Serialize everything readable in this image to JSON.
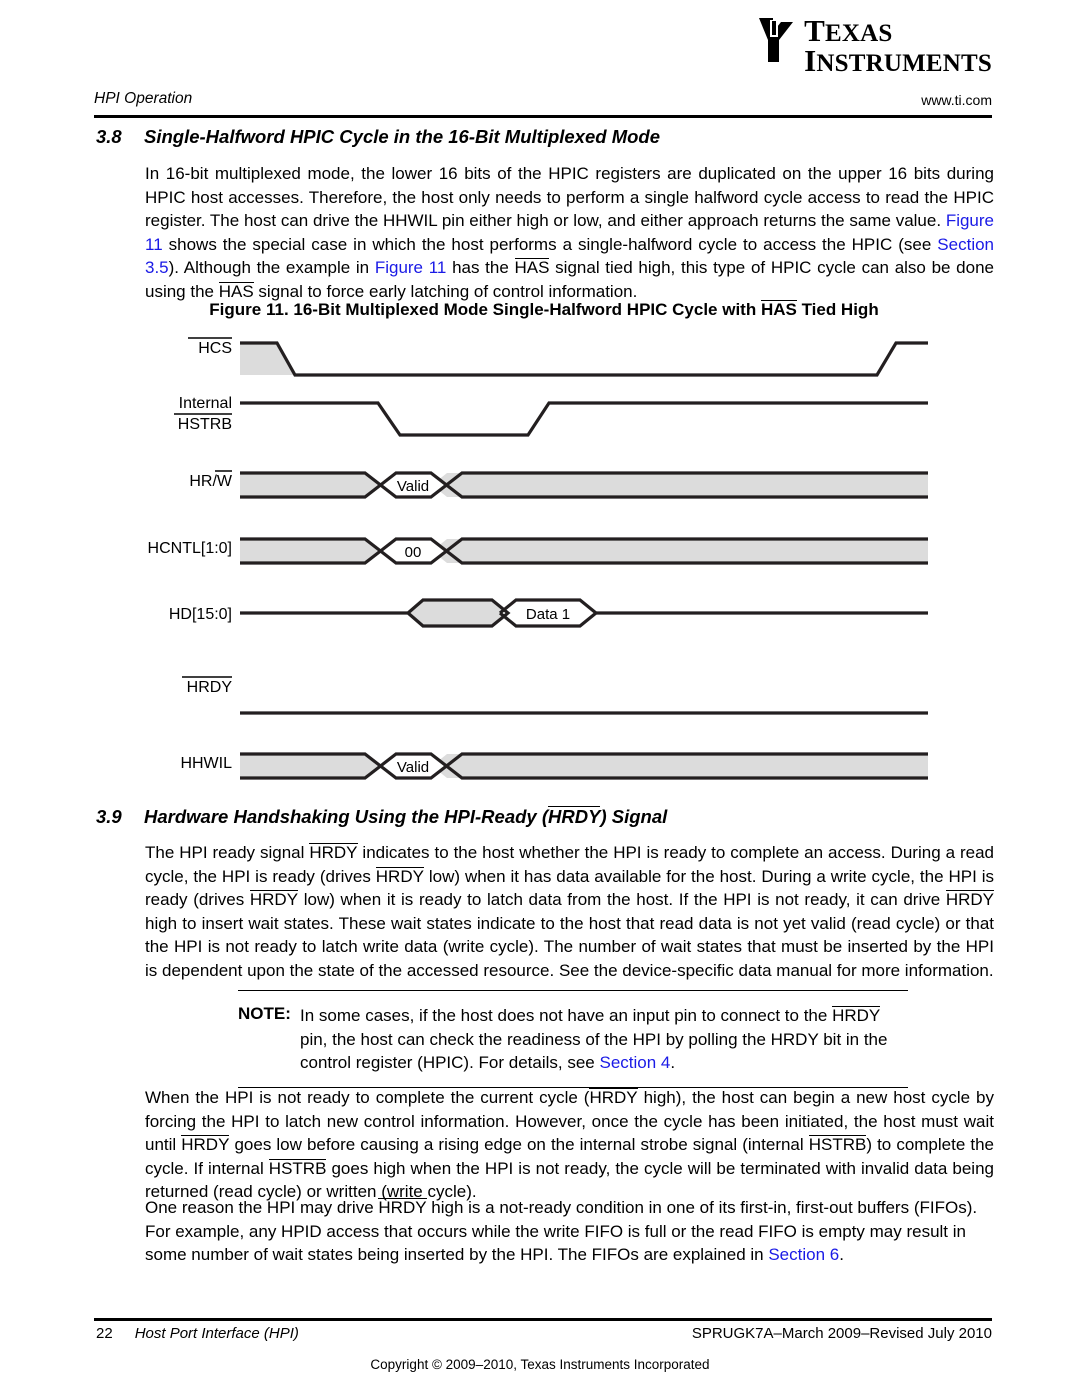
{
  "logo": {
    "line1": "TEXAS",
    "line2": "INSTRUMENTS",
    "mark_name": "ti-flame-mark"
  },
  "header": {
    "left": "HPI Operation",
    "right": "www.ti.com"
  },
  "sections": [
    {
      "number": "3.8",
      "title": "Single-Halfword HPIC Cycle in the 16-Bit Multiplexed Mode"
    },
    {
      "number": "3.9",
      "title_pre": "Hardware Handshaking Using the HPI-Ready (",
      "title_ovl": "HRDY",
      "title_post": ") Signal"
    }
  ],
  "paragraph_38": {
    "t1": "In 16-bit multiplexed mode, the lower 16 bits of the HPIC registers are duplicated on the upper 16 bits during HPIC host accesses. Therefore, the host only needs to perform a single halfword cycle access to read the HPIC register. The host can drive the HHWIL pin either high or low, and either approach returns the same value. ",
    "link1": "Figure 11",
    "t2": " shows the special case in which the host performs a single-halfword cycle to access the HPIC (see ",
    "link2": "Section 3.5",
    "t3": "). Although the example in ",
    "link3": "Figure 11",
    "t4": " has the ",
    "ovl1": "HAS",
    "t5": " signal tied high, this type of HPIC cycle can also be done using the ",
    "ovl2": "HAS",
    "t6": " signal to force early latching of control information."
  },
  "figure": {
    "caption_pre": "Figure 11. 16-Bit Multiplexed Mode Single-Halfword HPIC Cycle with ",
    "caption_ovl": "HAS",
    "caption_post": " Tied High",
    "signals": [
      {
        "name": "HCS",
        "overline": true,
        "type": "strobe"
      },
      {
        "name_line1": "Internal",
        "name": "HSTRB",
        "overline": true,
        "type": "strobe"
      },
      {
        "name": "HR/W",
        "overline_part": "W",
        "type": "bus",
        "value": "Valid"
      },
      {
        "name": "HCNTL[1:0]",
        "type": "bus",
        "value": "00"
      },
      {
        "name": "HD[15:0]",
        "type": "data",
        "value": "Data 1"
      },
      {
        "name": "HRDY",
        "overline": true,
        "type": "low"
      },
      {
        "name": "HHWIL",
        "type": "bus",
        "value": "Valid"
      }
    ],
    "colors": {
      "line": "#231f20",
      "fill_gray": "#dcdcdc",
      "fill_white": "#ffffff"
    }
  },
  "paragraph_39": {
    "t1": "The HPI ready signal ",
    "ovl1": "HRDY",
    "t2": " indicates to the host whether the HPI is ready to complete an access. During a read cycle, the HPI is ready (drives ",
    "ovl2": "HRDY",
    "t3": " low) when it has data available for the host. During a write cycle, the HPI is ready (drives ",
    "ovl3": "HRDY",
    "t4": " low) when it is ready to latch data from the host. If the HPI is not ready, it can drive ",
    "ovl4": "HRDY",
    "t5": " high to insert wait states. These wait states indicate to the host that read data is not yet valid (read cycle) or that the HPI is not ready to latch write data (write cycle). The number of wait states that must be inserted by the HPI is dependent upon the state of the accessed resource. See the device-specific data manual for more information."
  },
  "note": {
    "label": "NOTE:",
    "t1": "In some cases, if the host does not have an input pin to connect to the ",
    "ovl1": "HRDY",
    "t2": " pin, the host can check the readiness of the HPI by polling the HRDY bit in the control register (HPIC). For details, see ",
    "link1": "Section 4",
    "t3": "."
  },
  "paragraph_ready": {
    "t1": "When the HPI is not ready to complete the current cycle (",
    "ovl1": "HRDY",
    "t2": " high), the host can begin a new host cycle by forcing the HPI to latch new control information. However, once the cycle has been initiated, the host must wait until ",
    "ovl2": "HRDY",
    "t3": " goes low before causing a rising edge on the internal strobe signal (internal ",
    "ovl3": "HSTRB",
    "t4": ") to complete the cycle. If internal ",
    "ovl4": "HSTRB",
    "t5": " goes high when the HPI is not ready, the cycle will be terminated with invalid data being returned (read cycle) or written (write cycle)."
  },
  "paragraph_fifo": {
    "t1": "One reason the HPI may drive ",
    "ovl1": "HRDY",
    "t2": " high is a not-ready condition in one of its first-in, first-out buffers (FIFOs). For example, any HPID access that occurs while the write FIFO is full or the read FIFO is empty may result in some number of wait states being inserted by the HPI. The FIFOs are explained in ",
    "link1": "Section 6",
    "t3": "."
  },
  "footer": {
    "page": "22",
    "doc": "Host Port Interface (HPI)",
    "right": "SPRUGK7A–March 2009–Revised July 2010",
    "copyright": "Copyright © 2009–2010, Texas Instruments Incorporated"
  }
}
